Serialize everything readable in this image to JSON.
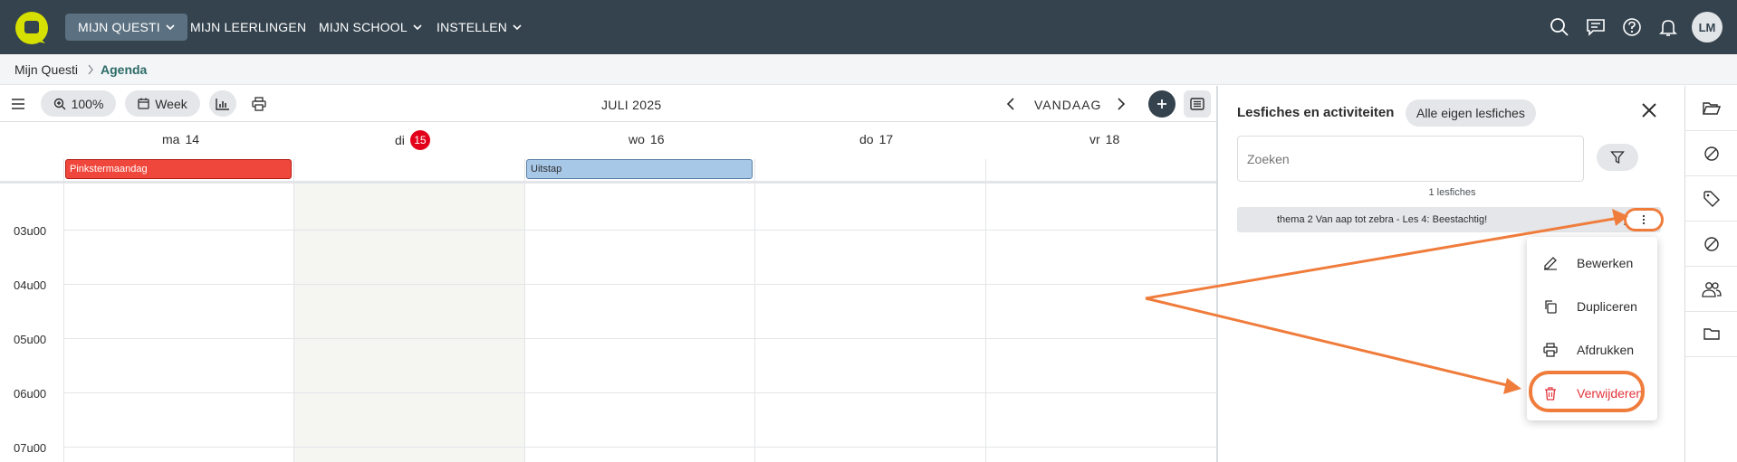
{
  "nav": {
    "items": [
      {
        "label": "MIJN QUESTI",
        "active": true,
        "dropdown": true
      },
      {
        "label": "MIJN LEERLINGEN",
        "active": false,
        "dropdown": false
      },
      {
        "label": "MIJN SCHOOL",
        "active": false,
        "dropdown": true
      },
      {
        "label": "INSTELLEN",
        "active": false,
        "dropdown": true
      }
    ],
    "icons": [
      "search-icon",
      "message-icon",
      "help-icon",
      "bell-icon"
    ],
    "avatar_initials": "LM",
    "brand_color": "#d6e000",
    "bar_color": "#34434e"
  },
  "breadcrumb": {
    "root": "Mijn Questi",
    "current": "Agenda"
  },
  "toolbar": {
    "zoom": "100%",
    "view": "Week",
    "month": "JULI 2025",
    "today": "VANDAAG"
  },
  "calendar": {
    "days": [
      {
        "name": "ma",
        "num": "14"
      },
      {
        "name": "di",
        "num": "15",
        "today": true
      },
      {
        "name": "wo",
        "num": "16"
      },
      {
        "name": "do",
        "num": "17"
      },
      {
        "name": "vr",
        "num": "18"
      }
    ],
    "events": [
      {
        "label": "Pinkstermaandag",
        "day": "ma 14",
        "color": "#f0473c"
      },
      {
        "label": "Uitstap",
        "day": "wo 16",
        "color": "#a8c8e8"
      }
    ],
    "hours": [
      "03u00",
      "04u00",
      "05u00",
      "06u00",
      "07u00"
    ]
  },
  "panel": {
    "title": "Lesfiches en activiteiten",
    "filter_chip": "Alle eigen lesfiches",
    "search_placeholder": "Zoeken",
    "count": "1 lesfiches",
    "item": "thema 2 Van aap tot zebra - Les 4: Beestachtig!"
  },
  "menu": {
    "items": [
      {
        "label": "Bewerken",
        "icon": "edit-icon"
      },
      {
        "label": "Dupliceren",
        "icon": "copy-icon"
      },
      {
        "label": "Afdrukken",
        "icon": "print-icon"
      },
      {
        "label": "Verwijderen",
        "icon": "trash-icon",
        "danger": true
      }
    ]
  },
  "rail": {
    "icons": [
      "folder-open-icon",
      "no-symbol-icon",
      "tag-icon",
      "no-symbol-icon",
      "users-icon",
      "folder-icon"
    ]
  },
  "annotation_color": "#f07c3c"
}
